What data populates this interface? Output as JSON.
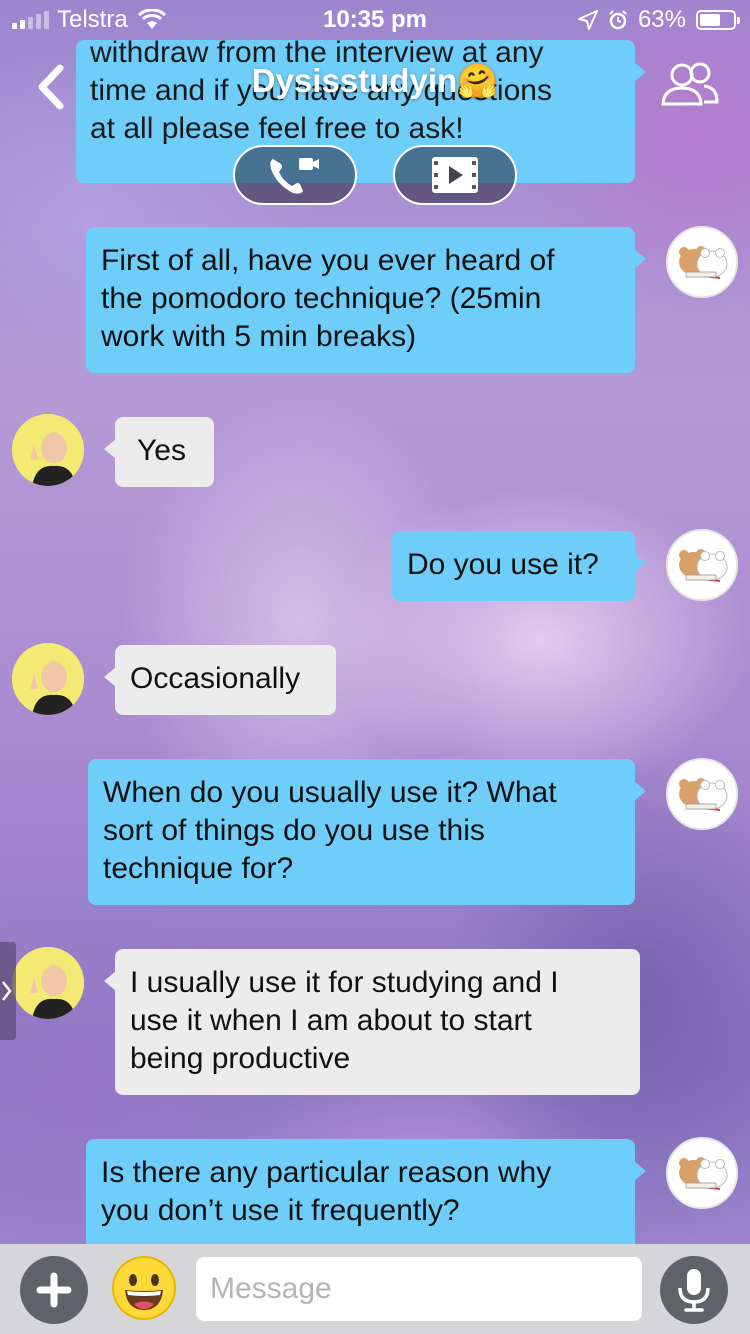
{
  "status_bar": {
    "carrier": "Telstra",
    "time": "10:35 pm",
    "battery": "63%",
    "battery_level": 0.63
  },
  "header": {
    "title": "Dysisstudyin🤗",
    "back_icon": "chevron-left-icon",
    "members_icon": "members-icon",
    "call_icon": "phone-video-icon",
    "video_icon": "screening-room-icon"
  },
  "messages": [
    {
      "sender": "me",
      "text": "withdraw from the interview at any\ntime and if you have any questions\nat all please feel free to ask!"
    },
    {
      "sender": "me",
      "text": "First of all, have you ever heard of\nthe pomodoro technique? (25min\nwork with 5 min breaks)"
    },
    {
      "sender": "them",
      "text": "Yes"
    },
    {
      "sender": "me",
      "text": "Do you use it?"
    },
    {
      "sender": "them",
      "text": "Occasionally"
    },
    {
      "sender": "me",
      "text": "When do you usually use it? What\nsort of things do you use this\ntechnique for?"
    },
    {
      "sender": "them",
      "text": "I usually use it for studying and I\nuse it when I am about to start\nbeing productive"
    },
    {
      "sender": "me",
      "text": "Is there any particular reason why\nyou don’t use it frequently?"
    }
  ],
  "composer": {
    "placeholder": "Message",
    "plus_icon": "plus-icon",
    "emoji_icon": "smiley-emoji-icon",
    "mic_icon": "microphone-icon"
  },
  "colors": {
    "outgoing_bubble": "#6fcdf9",
    "incoming_bubble": "#ececec",
    "bottom_bar": "#d6d6d8"
  }
}
